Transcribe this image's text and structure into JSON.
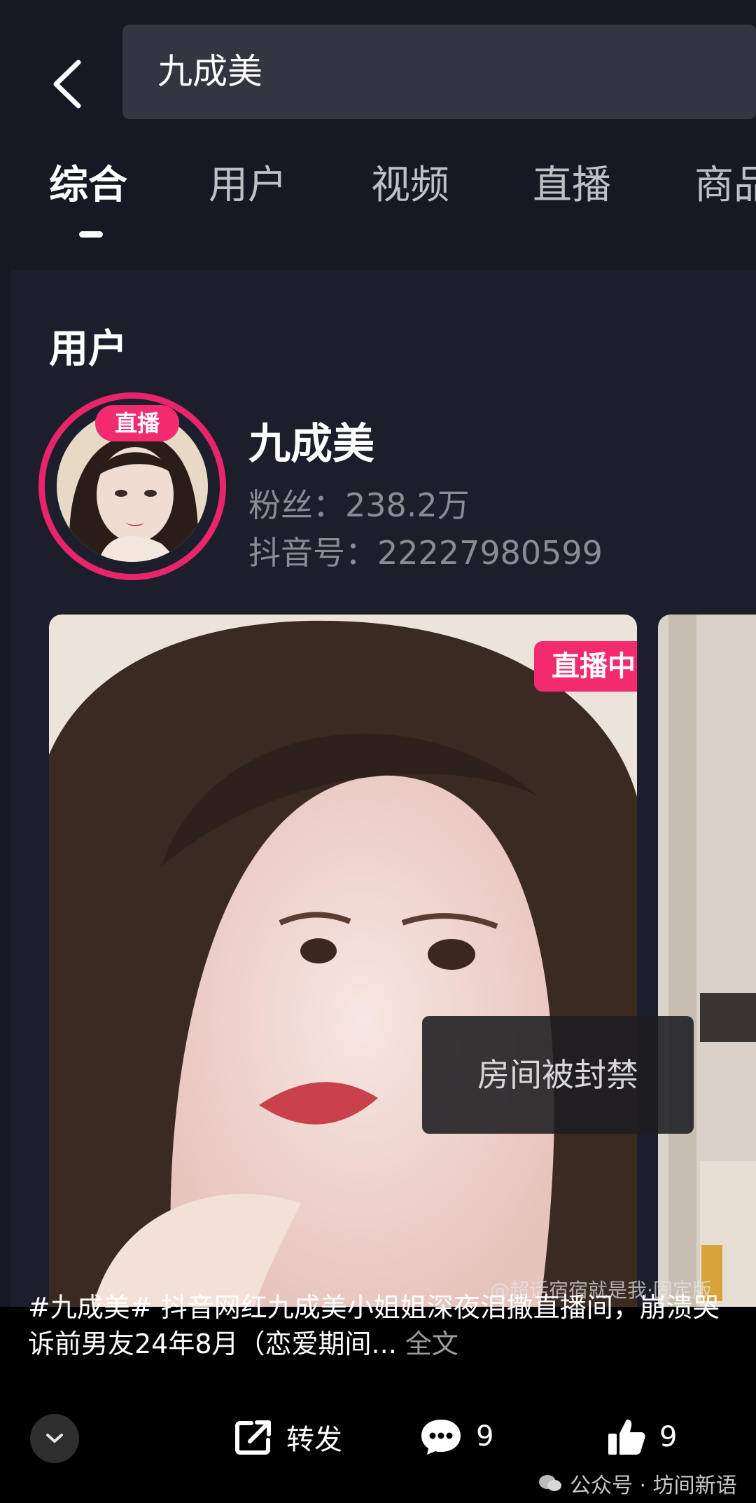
{
  "search": {
    "query": "九成美"
  },
  "tabs": [
    {
      "label": "综合"
    },
    {
      "label": "用户"
    },
    {
      "label": "视频"
    },
    {
      "label": "直播"
    },
    {
      "label": "商品"
    }
  ],
  "user_section": {
    "title": "用户",
    "avatar_badge": "直播",
    "name": "九成美",
    "fans_label": "粉丝：",
    "fans_value": "238.2万",
    "id_label": "抖音号：",
    "id_value": "22227980599"
  },
  "live_card": {
    "tag": "直播中",
    "toast": "房间被封禁"
  },
  "watermark": "@超话宿宿就是我·固定版",
  "caption": {
    "text": "#九成美# 抖音网红九成美小姐姐深夜泪撒直播间，崩溃哭诉前男友24年8月（恋爱期间...",
    "more": "全文"
  },
  "actions": {
    "share_label": "转发",
    "comment_count": "9",
    "like_count": "9"
  },
  "footer": {
    "text": "公众号 · 坊间新语"
  },
  "colors": {
    "background": "#161823",
    "card": "#1c1f2b",
    "accent_pink": "#f22a6e",
    "muted_text": "#8a8b93"
  }
}
